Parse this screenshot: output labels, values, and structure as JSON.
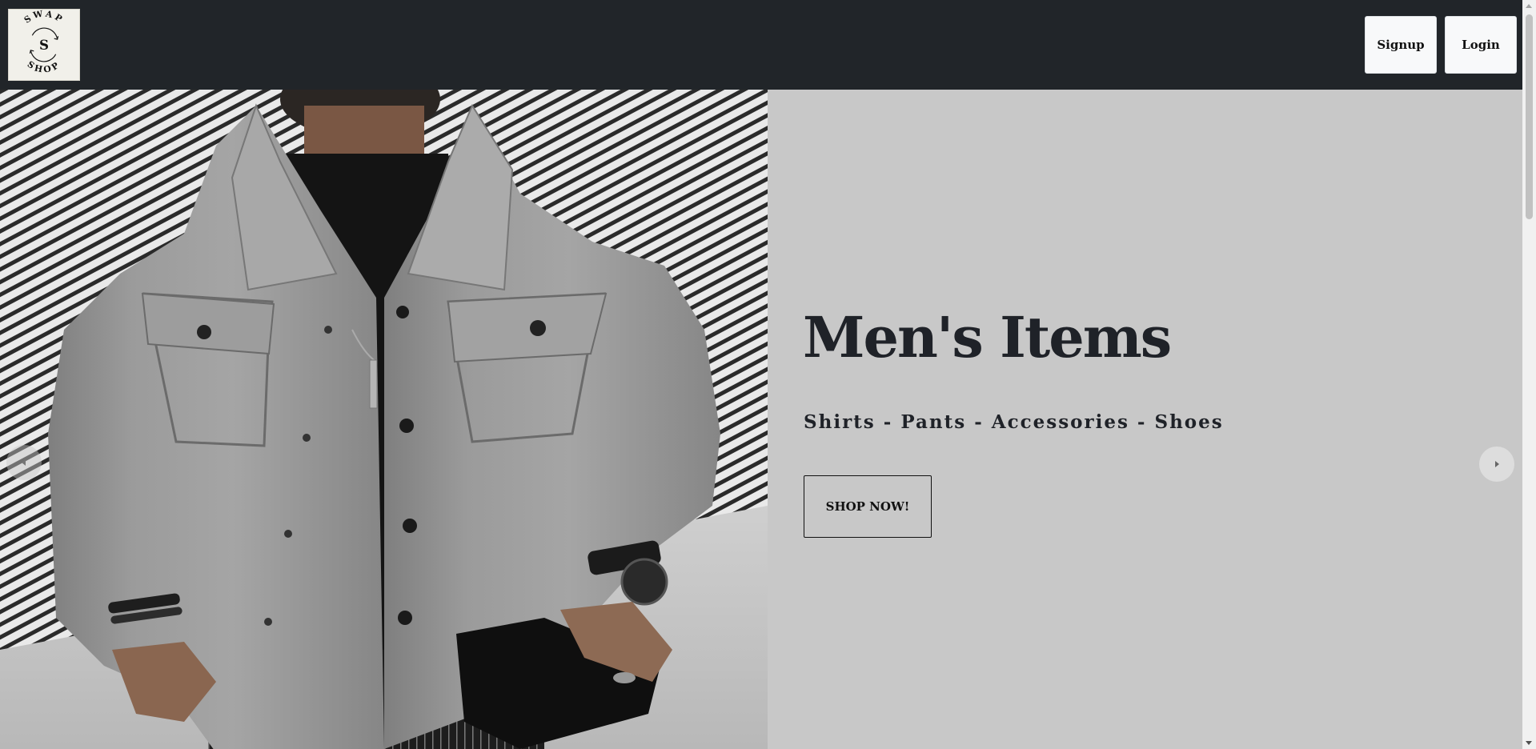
{
  "navbar": {
    "logo": {
      "top_text": "SWAP",
      "center_letter": "S",
      "bottom_text": "SHOP"
    },
    "signup_label": "Signup",
    "login_label": "Login",
    "background_color": "#212529"
  },
  "hero": {
    "title": "Men's Items",
    "subtitle": "Shirts - Pants - Accessories - Shoes",
    "cta_label": "SHOP NOW!",
    "background_color": "#c8c8c8",
    "image_icon": "man-in-grey-jacket-photo",
    "prev_icon": "chevron-left-icon",
    "next_icon": "chevron-right-icon"
  }
}
